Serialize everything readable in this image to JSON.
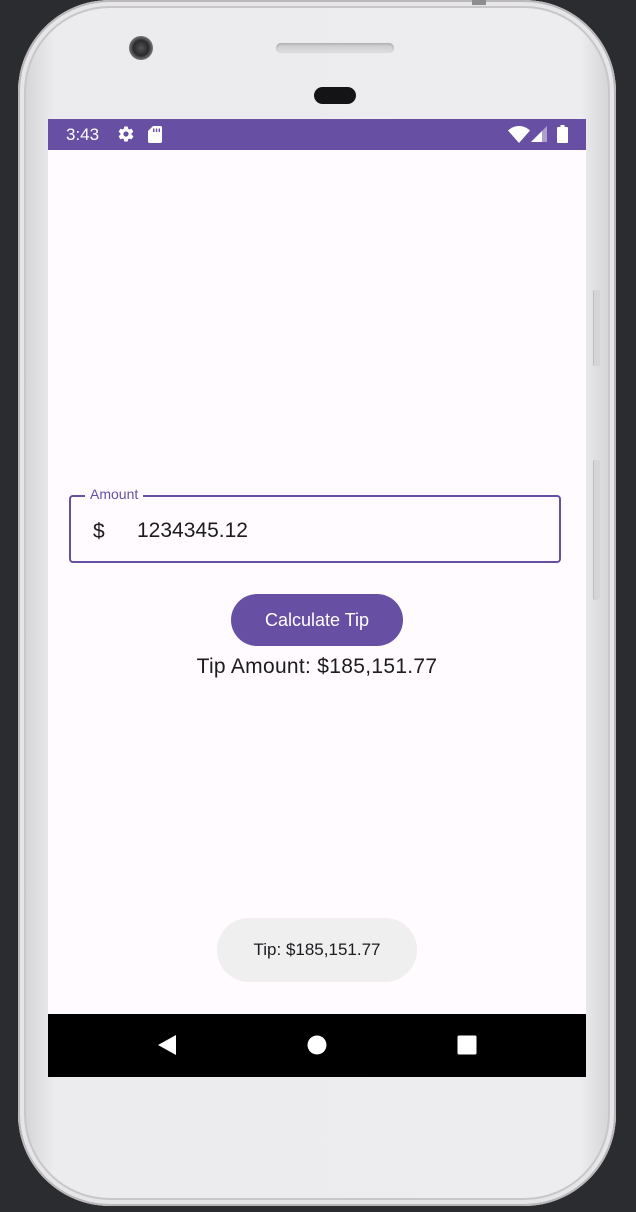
{
  "status_bar": {
    "time": "3:43",
    "icons": [
      "gear-icon",
      "sd-card-icon",
      "wifi-icon",
      "cell-signal-icon",
      "battery-icon"
    ],
    "color": "#6750a4"
  },
  "amount_field": {
    "label": "Amount",
    "prefix": "$",
    "value": "1234345.12"
  },
  "calculate_button": {
    "label": "Calculate Tip"
  },
  "tip_result": "Tip Amount: $185,151.77",
  "toast": "Tip: $185,151.77",
  "nav_bar": {
    "icons": [
      "back-icon",
      "home-icon",
      "recents-icon"
    ]
  },
  "colors": {
    "primary": "#6750a4",
    "background": "#fffbfe",
    "toast_bg": "#efefef"
  }
}
